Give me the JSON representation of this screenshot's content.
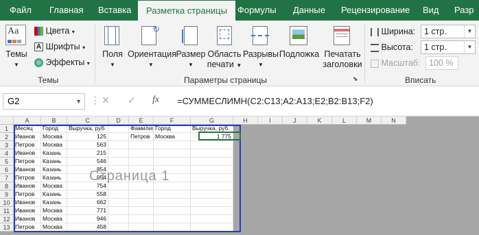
{
  "tabs": [
    {
      "label": "Файл",
      "active": false
    },
    {
      "label": "Главная",
      "active": false
    },
    {
      "label": "Вставка",
      "active": false
    },
    {
      "label": "Разметка страницы",
      "active": true
    },
    {
      "label": "Формулы",
      "active": false
    },
    {
      "label": "Данные",
      "active": false
    },
    {
      "label": "Рецензирование",
      "active": false
    },
    {
      "label": "Вид",
      "active": false
    },
    {
      "label": "Разр",
      "active": false
    }
  ],
  "ribbon": {
    "themes": {
      "themes_btn": "Темы",
      "colors": "Цвета",
      "fonts": "Шрифты",
      "effects": "Эффекты",
      "group_label": "Темы"
    },
    "page_setup": {
      "margins": "Поля",
      "orientation": "Ориентация",
      "size": "Размер",
      "print_area_1": "Область",
      "print_area_2": "печати",
      "breaks": "Разрывы",
      "background": "Подложка",
      "print_titles_1": "Печатать",
      "print_titles_2": "заголовки",
      "group_label": "Параметры страницы"
    },
    "scale": {
      "width_label": "Ширина:",
      "width_value": "1 стр.",
      "height_label": "Высота:",
      "height_value": "1 стр.",
      "scale_label": "Масштаб:",
      "scale_value": "100 %",
      "group_label": "Вписать"
    }
  },
  "formula_bar": {
    "name_box": "G2",
    "cancel": "✕",
    "enter": "✓",
    "fx": "fx",
    "formula": "=СУММЕСЛИМН(C2:C13;A2:A13;E2;B2:B13;F2)"
  },
  "sheet": {
    "columns": [
      "A",
      "B",
      "C",
      "D",
      "E",
      "F",
      "G",
      "H",
      "I",
      "J",
      "K",
      "L",
      "M",
      "N"
    ],
    "rows": [
      [
        "Месяц",
        "Город",
        "Выручка, руб.",
        "",
        "Фамилия",
        "Город",
        "Выручка, руб."
      ],
      [
        "Иванов",
        "Москва",
        "125",
        "",
        "Петров",
        "Москва",
        "1 775"
      ],
      [
        "Петров",
        "Москва",
        "563",
        "",
        "",
        "",
        ""
      ],
      [
        "Иванов",
        "Казань",
        "215",
        "",
        "",
        "",
        ""
      ],
      [
        "Петров",
        "Казань",
        "546",
        "",
        "",
        "",
        ""
      ],
      [
        "Иванов",
        "Казань",
        "854",
        "",
        "",
        "",
        ""
      ],
      [
        "Петров",
        "Казань",
        "954",
        "",
        "",
        "",
        ""
      ],
      [
        "Иванов",
        "Москва",
        "754",
        "",
        "",
        "",
        ""
      ],
      [
        "Петров",
        "Казань",
        "558",
        "",
        "",
        "",
        ""
      ],
      [
        "Иванов",
        "Казань",
        "662",
        "",
        "",
        "",
        ""
      ],
      [
        "Иванов",
        "Москва",
        "771",
        "",
        "",
        "",
        ""
      ],
      [
        "Иванов",
        "Москва",
        "946",
        "",
        "",
        "",
        ""
      ],
      [
        "Петров",
        "Москва",
        "458",
        "",
        "",
        "",
        ""
      ]
    ],
    "row_numbers": [
      "1",
      "2",
      "3",
      "4",
      "5",
      "6",
      "7",
      "8",
      "9",
      "10",
      "11",
      "12",
      "13"
    ],
    "watermark": "Страница 1"
  }
}
